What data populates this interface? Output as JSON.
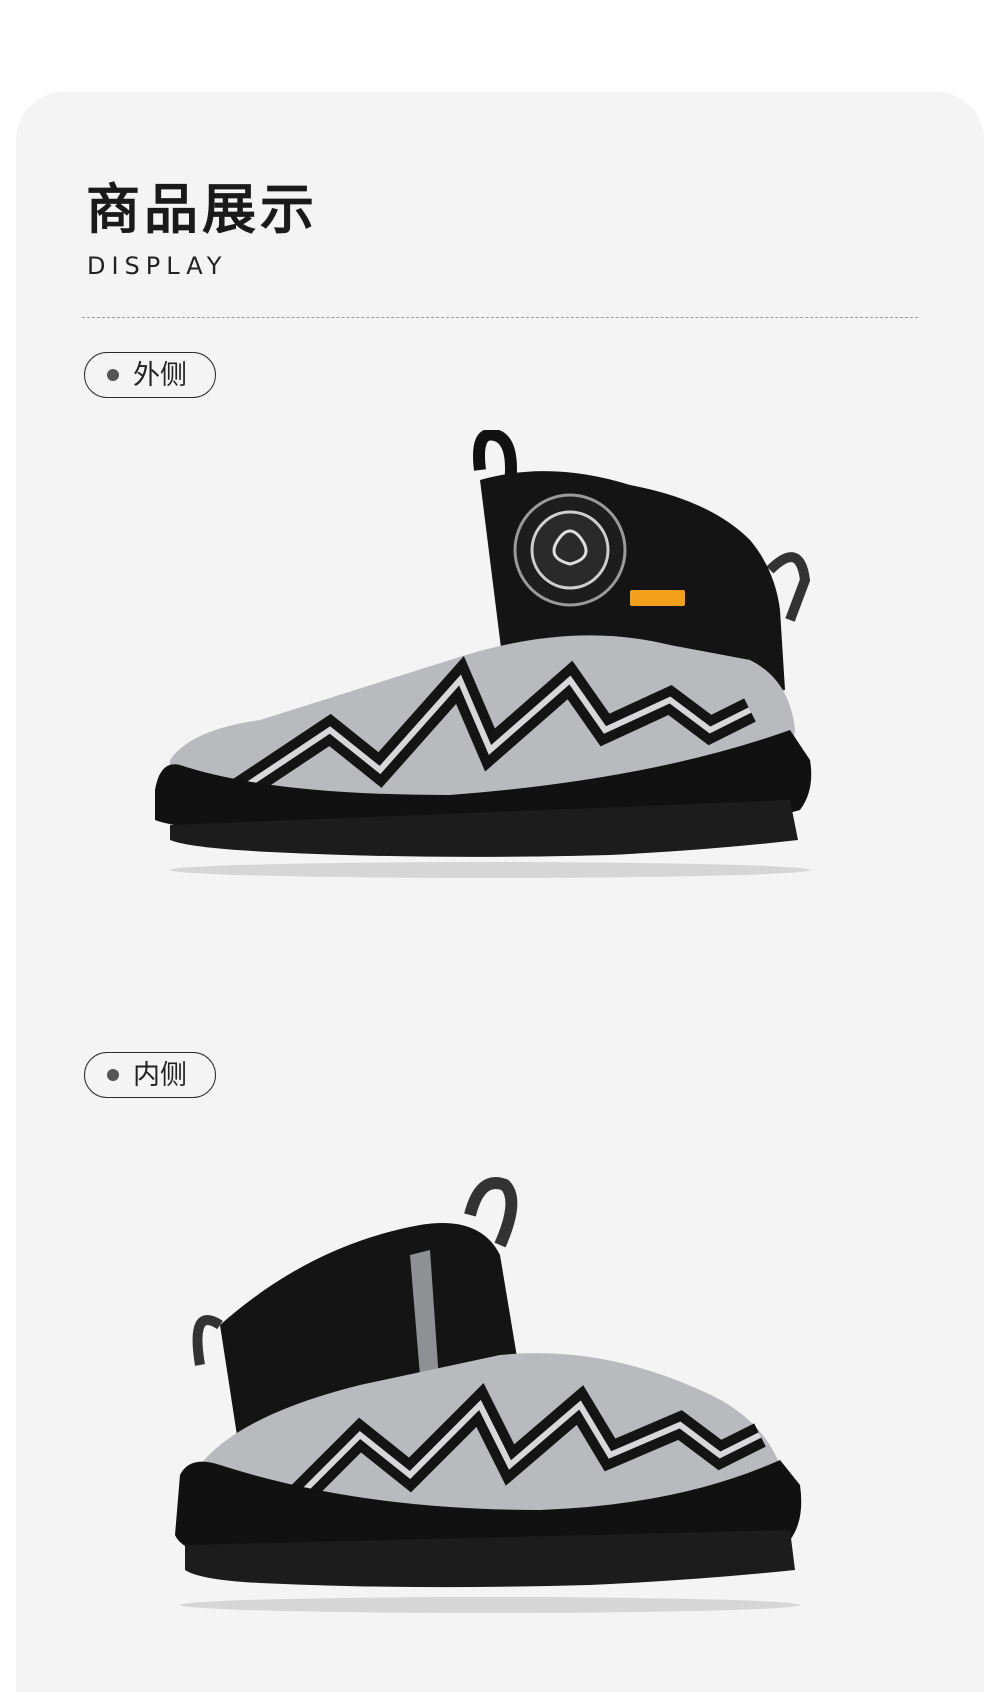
{
  "section": {
    "title": "商品展示",
    "subtitle": "DISPLAY"
  },
  "views": [
    {
      "label": "外侧"
    },
    {
      "label": "内侧"
    }
  ],
  "colors": {
    "panel": "#f4f4f4",
    "shoe_black": "#161616",
    "shoe_silver": "#b9babd",
    "accent_orange": "#f3a01a"
  }
}
